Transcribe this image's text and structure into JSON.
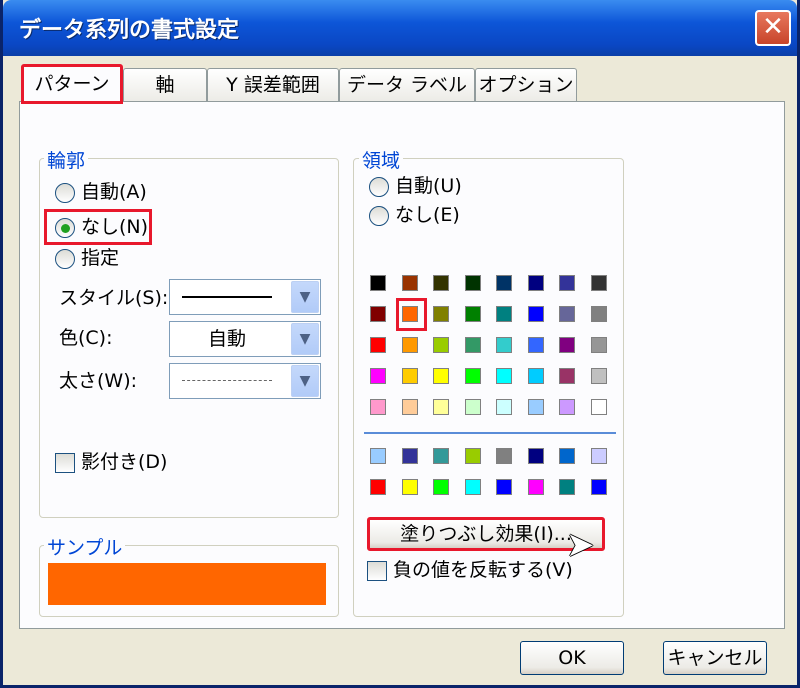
{
  "window": {
    "title": "データ系列の書式設定",
    "close_label": "✕"
  },
  "tabs": [
    {
      "label": "パターン",
      "active": true
    },
    {
      "label": "軸"
    },
    {
      "label": "Y 誤差範囲"
    },
    {
      "label": "データ ラベル"
    },
    {
      "label": "オプション"
    }
  ],
  "border_group": {
    "title": "輪郭",
    "radio_auto": "自動(A)",
    "radio_none": "なし(N)",
    "radio_custom": "指定",
    "style_label": "スタイル(S):",
    "color_label": "色(C):",
    "color_value": "自動",
    "weight_label": "太さ(W):",
    "shadow_label": "影付き(D)"
  },
  "area_group": {
    "title": "領域",
    "radio_auto": "自動(U)",
    "radio_none": "なし(E)",
    "fill_effects_button": "塗りつぶし効果(I)...",
    "invert_label": "負の値を反転する(V)"
  },
  "sample": {
    "title": "サンプル",
    "color": "#ff6600"
  },
  "palette_top": [
    [
      "#000000",
      "#993300",
      "#333300",
      "#003300",
      "#003366",
      "#000080",
      "#333399",
      "#333333"
    ],
    [
      "#800000",
      "#ff6600",
      "#808000",
      "#008000",
      "#008080",
      "#0000ff",
      "#666699",
      "#808080"
    ],
    [
      "#ff0000",
      "#ff9900",
      "#99cc00",
      "#339966",
      "#33cccc",
      "#3366ff",
      "#800080",
      "#969696"
    ],
    [
      "#ff00ff",
      "#ffcc00",
      "#ffff00",
      "#00ff00",
      "#00ffff",
      "#00ccff",
      "#993366",
      "#c0c0c0"
    ],
    [
      "#ff99cc",
      "#ffcc99",
      "#ffff99",
      "#ccffcc",
      "#ccffff",
      "#99ccff",
      "#cc99ff",
      "#ffffff"
    ]
  ],
  "palette_bottom": [
    [
      "#99ccff",
      "#333399",
      "#339999",
      "#99cc00",
      "#808080",
      "#000080",
      "#0066cc",
      "#ccccff"
    ],
    [
      "#ff0000",
      "#ffff00",
      "#00ff00",
      "#00ffff",
      "#0000ff",
      "#ff00ff",
      "#008080",
      "#0000ff"
    ]
  ],
  "buttons": {
    "ok": "OK",
    "cancel": "キャンセル"
  }
}
